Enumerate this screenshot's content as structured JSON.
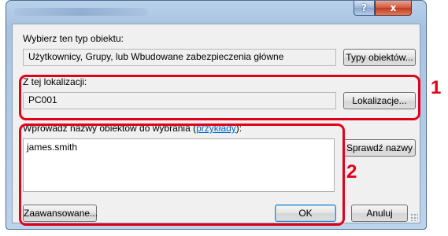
{
  "titlebar": {
    "help_symbol": "?",
    "close_symbol": "x"
  },
  "object_type": {
    "label": "Wybierz ten typ obiektu:",
    "value": "Użytkownicy, Grupy, lub Wbudowane zabezpieczenia główne",
    "button": "Typy obiektów..."
  },
  "location": {
    "label": "Z tej lokalizacji:",
    "value": "PC001",
    "button": "Lokalizacje..."
  },
  "names": {
    "label_before": "Wprowadź nazwy obiektów do wybrania (",
    "examples_link": "przykłady",
    "label_after": "):",
    "value": "james.smith",
    "check_button": "Sprawdź nazwy"
  },
  "footer": {
    "advanced_button": "Zaawansowane...",
    "ok_button": "OK",
    "cancel_button": "Anuluj"
  },
  "callouts": {
    "one": "1",
    "two": "2"
  },
  "colors": {
    "highlight": "#e0001a",
    "link": "#0066cc"
  }
}
